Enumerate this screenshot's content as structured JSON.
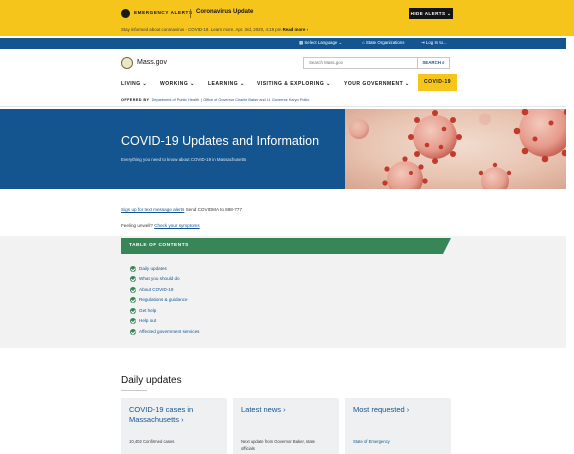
{
  "emergency": {
    "label": "EMERGENCY ALERTS",
    "title": "Coronavirus Update",
    "hide_button": "HIDE ALERTS ⌄",
    "subtext": "Stay informed about coronavirus - COVID-19. Learn more.",
    "subtext_time": "Apr. 3rd, 2020, 4:19 pm",
    "read_more": "Read more ›"
  },
  "utility": {
    "language": "Select Language ⌄",
    "orgs": "State Organizations",
    "login": "Log In to..."
  },
  "header": {
    "logo_text": "Mass.gov",
    "search_placeholder": "Search Mass.gov",
    "search_button": "SEARCH"
  },
  "mainnav": {
    "items": [
      "LIVING ⌄",
      "WORKING ⌄",
      "LEARNING ⌄",
      "VISITING & EXPLORING ⌄",
      "YOUR GOVERNMENT ⌄"
    ],
    "active": "COVID-19"
  },
  "offered": {
    "label": "OFFERED BY",
    "org1": "Department of Public Health",
    "org2": "Office of Governor Charlie Baker and Lt. Governor Karyn Polito"
  },
  "hero": {
    "title": "COVID-19 Updates and Information",
    "subtitle": "Everything you need to know about COVID-19 in Massachusetts"
  },
  "body": {
    "alert_link": "Sign up for text message alerts",
    "alert_rest": "Send COVIDMA to 888-777",
    "feeling_prefix": "Feeling unwell?",
    "feeling_link": "Check your symptoms"
  },
  "toc": {
    "label": "TABLE OF CONTENTS",
    "items": [
      "Daily updates",
      "What you should do",
      "About COVID-19",
      "Regulations & guidance",
      "Get help",
      "Help out",
      "Affected government services"
    ]
  },
  "daily": {
    "title": "Daily updates",
    "cards": [
      {
        "title": "COVID-19 cases in Massachusetts ›",
        "meta": "10,402 Confirmed cases"
      },
      {
        "title": "Latest news ›",
        "meta": "Next update from Governor Baker, state officials"
      },
      {
        "title": "Most requested ›",
        "meta": "State of Emergency"
      }
    ]
  },
  "colors": {
    "alert_yellow": "#f6c51b",
    "mass_blue": "#14558f",
    "toc_green": "#388557"
  }
}
